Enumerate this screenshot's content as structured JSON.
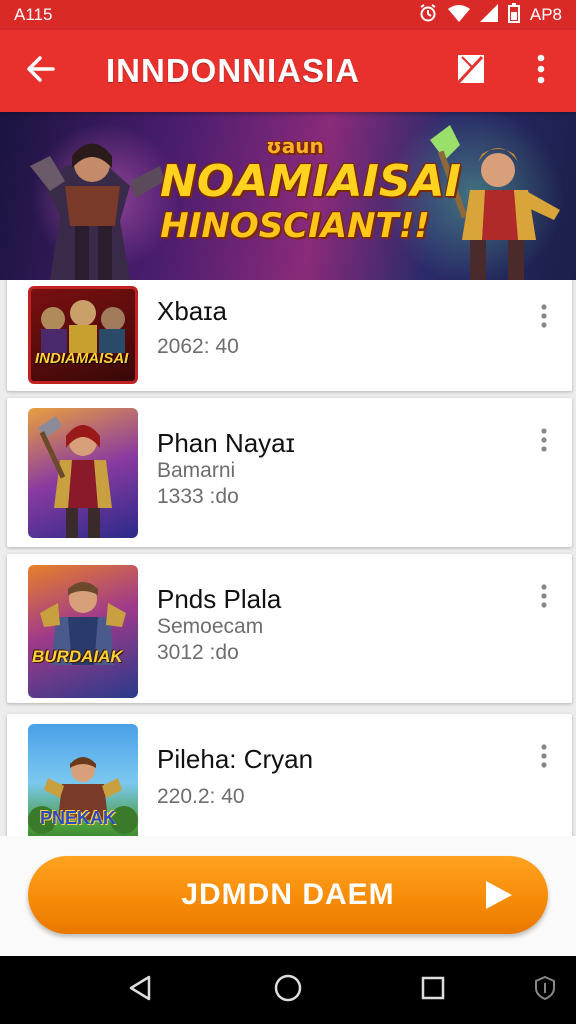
{
  "status_bar": {
    "time": "A115",
    "right_text": "AP8",
    "icons": [
      "alarm-icon",
      "wifi-icon",
      "signal-icon",
      "battery-icon"
    ]
  },
  "app_bar": {
    "title": "INNDONNIASIA",
    "icons": [
      "back-arrow-icon",
      "bookmark-flag-icon",
      "more-vert-icon"
    ]
  },
  "banner": {
    "small_text": "ʊaun",
    "line1": "NOAMIAISAI",
    "line2": "HINOSCIANT!!"
  },
  "items": [
    {
      "title": "Xbaɪa",
      "subtitle": "",
      "meta": "2062: 40",
      "thumb_text": "INDIAMAISAI"
    },
    {
      "title": "Phan Nayaɪ",
      "subtitle": "Bamarni",
      "meta": "1333 :do",
      "thumb_text": ""
    },
    {
      "title": "Pnds Plala",
      "subtitle": "Semoecam",
      "meta": "3012 :do",
      "thumb_text": "BURDAIAK"
    },
    {
      "title": "Pileha: Cryan",
      "subtitle": "",
      "meta": "220.2: 40",
      "thumb_text": "PNEKAK"
    }
  ],
  "cta": {
    "label": "JDMDN DAEM"
  },
  "nav": [
    "back-triangle-icon",
    "home-circle-icon",
    "recents-square-icon",
    "shield-icon"
  ],
  "colors": {
    "status_bar": "#d92a28",
    "app_bar": "#e8312d",
    "cta": "#f68a06",
    "nav_bar": "#000000"
  }
}
